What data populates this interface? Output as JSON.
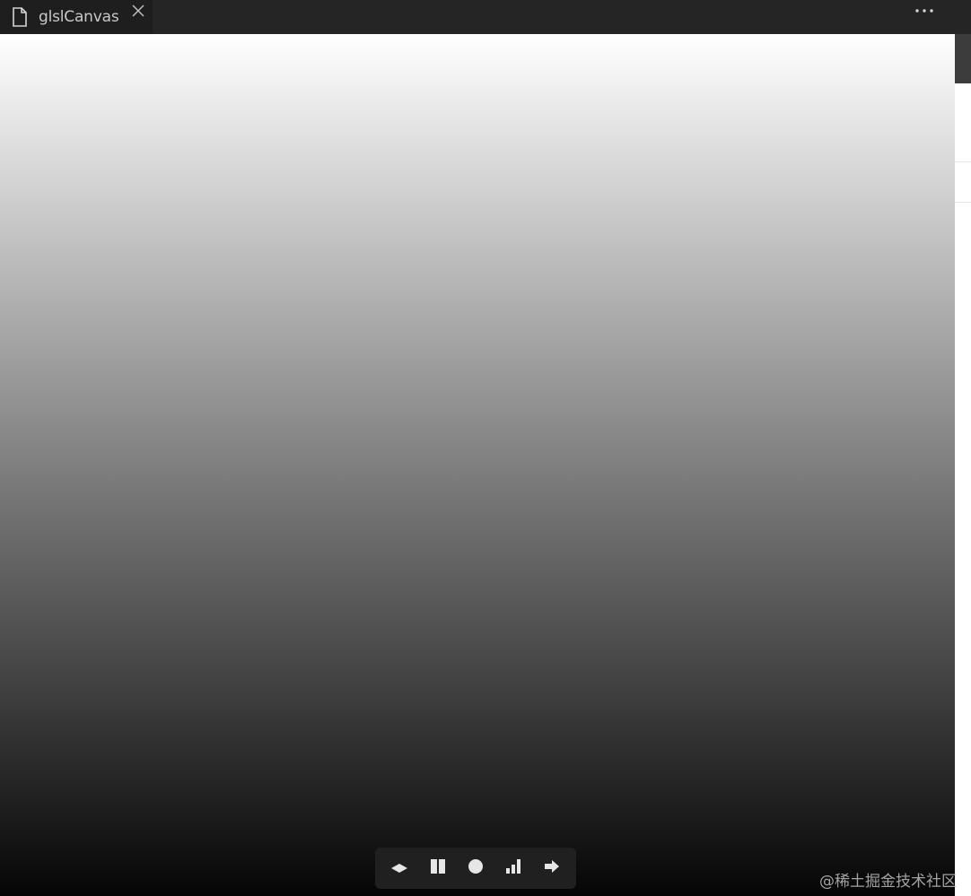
{
  "tab": {
    "title": "glslCanvas",
    "icon": "file-icon",
    "close_icon": "close-icon"
  },
  "toolbar": {
    "more_icon": "ellipsis-icon"
  },
  "canvas": {
    "gradient_top": "#ffffff",
    "gradient_bottom": "#050505"
  },
  "controls": [
    {
      "name": "layers-icon"
    },
    {
      "name": "pause-icon"
    },
    {
      "name": "record-icon"
    },
    {
      "name": "stats-icon"
    },
    {
      "name": "arrow-right-icon"
    }
  ],
  "watermark": "@稀土掘金技术社区",
  "colors": {
    "tabbar_bg": "#252526",
    "active_tab_bg": "#1e1e1e",
    "control_bar_bg": "#202020",
    "icon_fill": "#e6e6e6"
  }
}
